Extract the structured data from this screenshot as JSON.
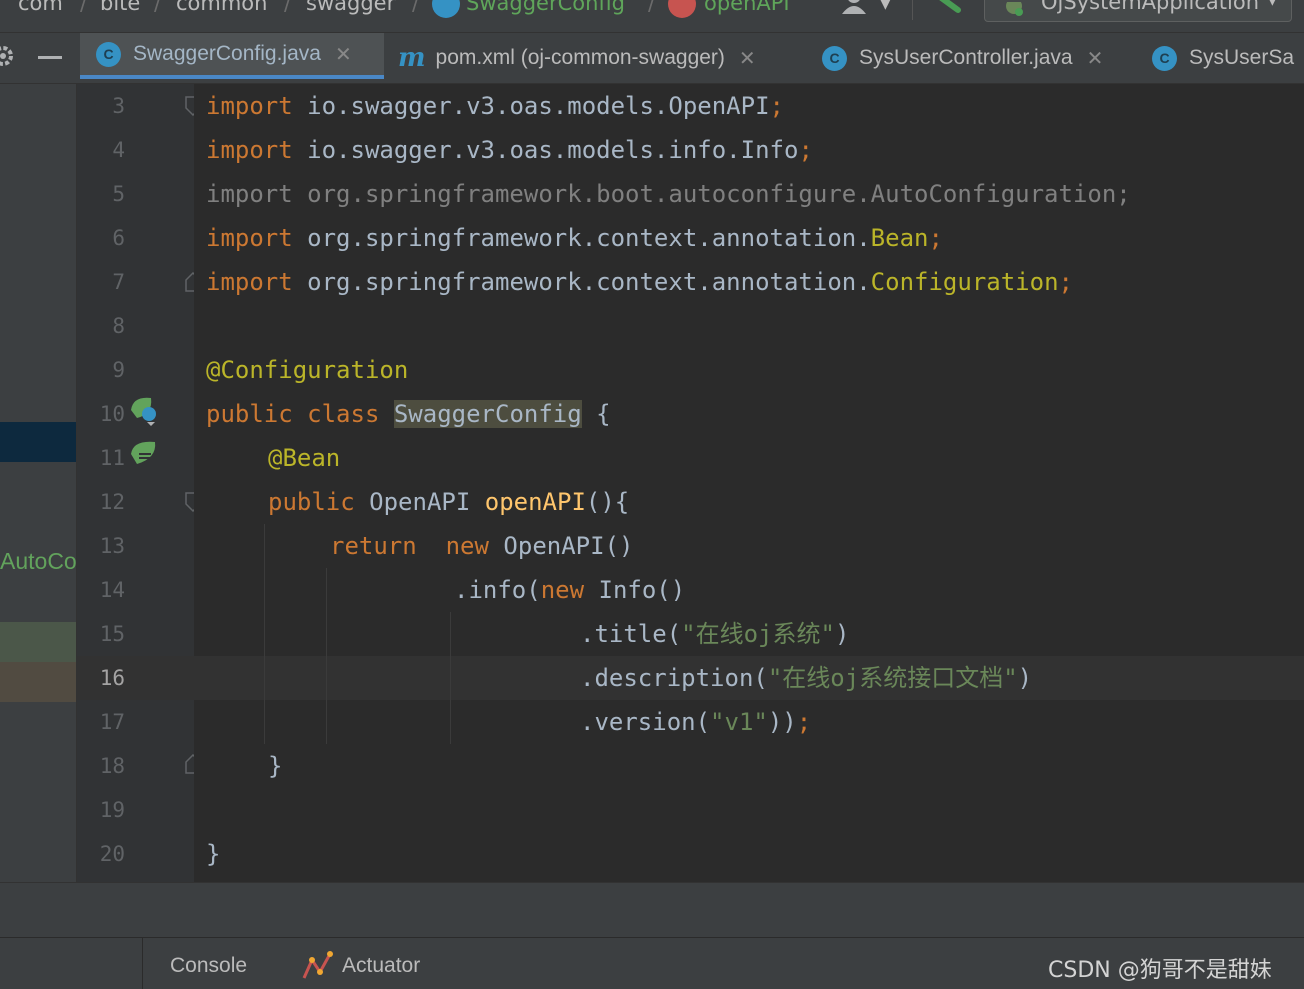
{
  "breadcrumb": {
    "items": [
      "com",
      "bite",
      "common",
      "swagger",
      "SwaggerConfig",
      "openAPI"
    ],
    "separator": "/"
  },
  "run_config": {
    "label": "OjSystemApplication"
  },
  "tabs": [
    {
      "label": "SwaggerConfig.java",
      "icon": "C",
      "active": true
    },
    {
      "label": "pom.xml (oj-common-swagger)",
      "icon": "m",
      "active": false
    },
    {
      "label": "SysUserController.java",
      "icon": "C",
      "active": false
    },
    {
      "label": "SysUserSa",
      "icon": "C",
      "active": false
    }
  ],
  "sidebar_fragment": {
    "text": "AutoCo"
  },
  "editor": {
    "line_numbers": [
      "3",
      "4",
      "5",
      "6",
      "7",
      "8",
      "9",
      "10",
      "11",
      "12",
      "13",
      "14",
      "15",
      "16",
      "17",
      "18",
      "19",
      "20"
    ],
    "current_line": "16",
    "code": {
      "l3_kw": "import",
      "l3_rest": " io.swagger.v3.oas.models.OpenAPI",
      "l3_semi": ";",
      "l4_kw": "import",
      "l4_rest": " io.swagger.v3.oas.models.info.Info",
      "l4_semi": ";",
      "l5": "import org.springframework.boot.autoconfigure.AutoConfiguration;",
      "l6_kw": "import",
      "l6_rest": " org.springframework.context.annotation.",
      "l6_cls": "Bean",
      "l6_semi": ";",
      "l7_kw": "import",
      "l7_rest": " org.springframework.context.annotation.",
      "l7_cls": "Configuration",
      "l7_semi": ";",
      "l9_ann": "@Configuration",
      "l10_kw": "public class ",
      "l10_cls": "SwaggerConfig",
      "l10_rest": " {",
      "l11_ann": "@Bean",
      "l12_kw": "public ",
      "l12_type": "OpenAPI ",
      "l12_meth": "openAPI",
      "l12_rest": "(){",
      "l13_kw1": "return",
      "l13_kw2": "new",
      "l13_rest": " OpenAPI()",
      "l14_a": ".info(",
      "l14_kw": "new",
      "l14_b": " Info()",
      "l15_a": ".title(",
      "l15_str": "\"在线oj系统\"",
      "l15_b": ")",
      "l16_a": ".description(",
      "l16_str": "\"在线oj系统接口文档\"",
      "l16_b": ")",
      "l17_a": ".version(",
      "l17_str": "\"v1\"",
      "l17_b": "))",
      "l17_semi": ";",
      "l18": "}",
      "l20": "}"
    }
  },
  "bottom_tools": [
    {
      "label": "Console",
      "icon": "none"
    },
    {
      "label": "Actuator",
      "icon": "actuator-icon"
    }
  ],
  "watermark": "CSDN @狗哥不是甜妹",
  "colors": {
    "keyword": "#cc7832",
    "annotation": "#bbb529",
    "string": "#6a8759",
    "method": "#ffc66d",
    "text": "#a9b7c6",
    "tab_accent": "#4a88c7"
  }
}
